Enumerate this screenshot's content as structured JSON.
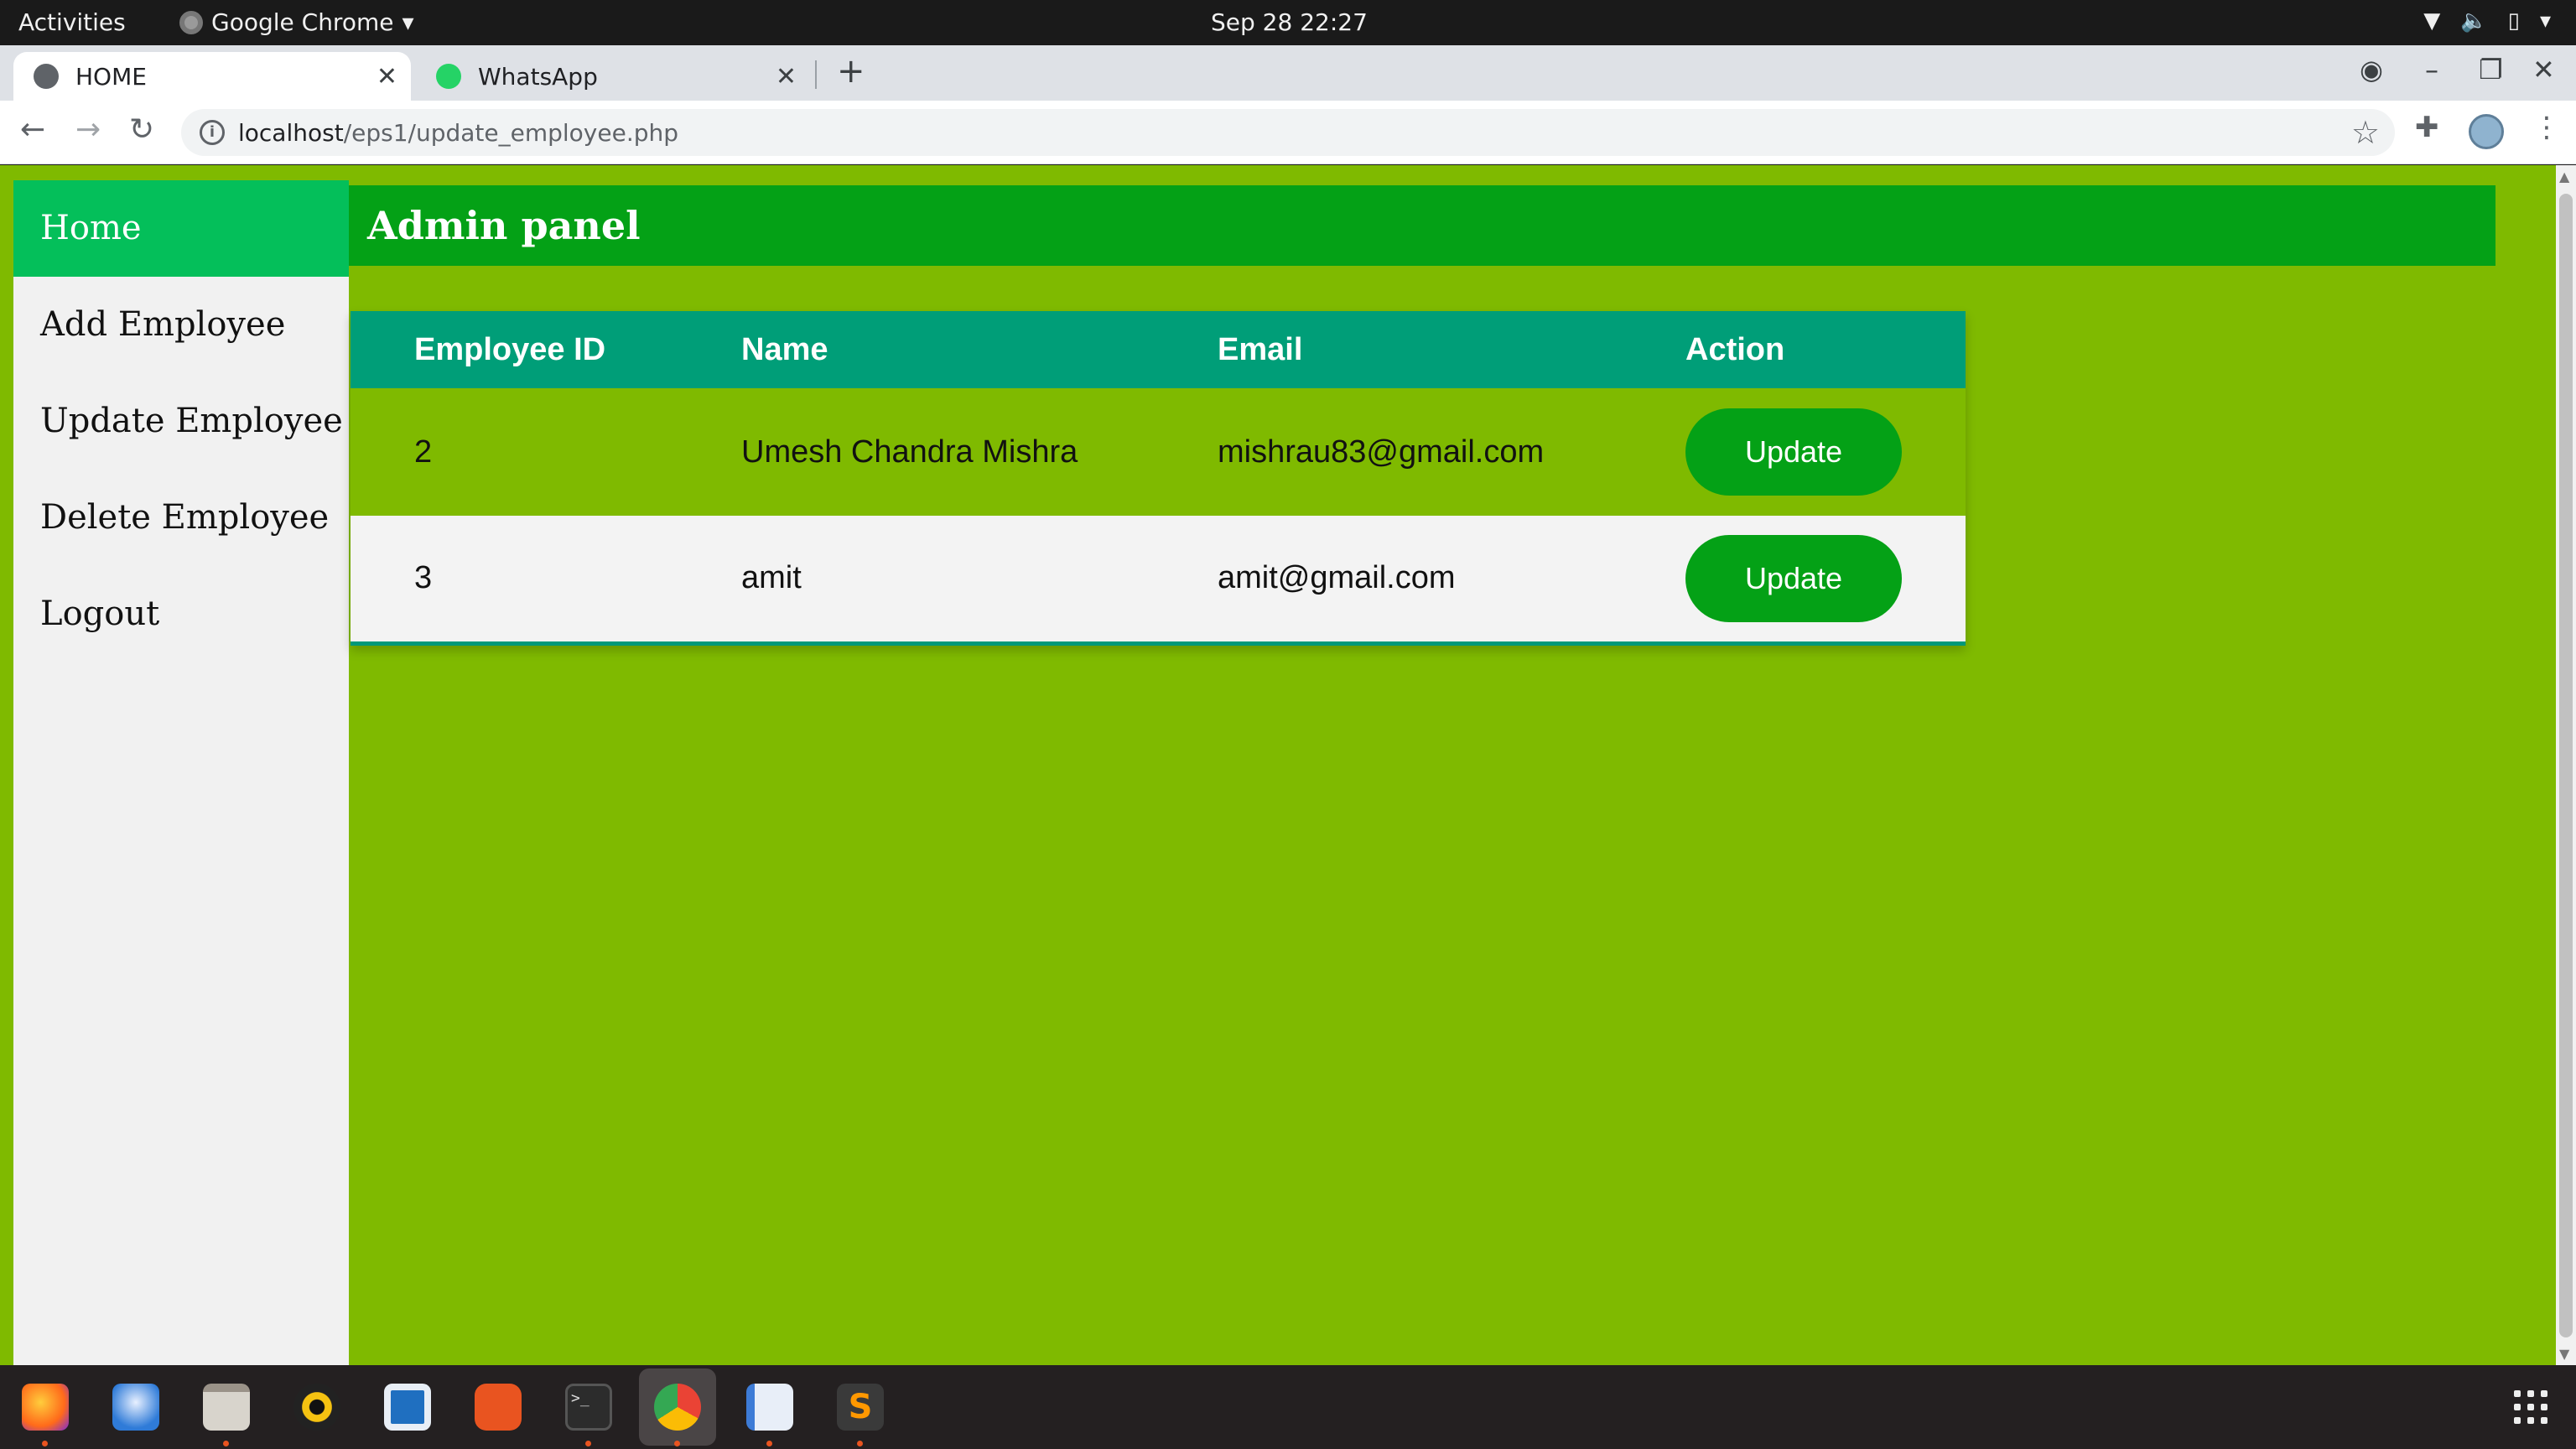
{
  "system_bar": {
    "activities": "Activities",
    "app_name": "Google Chrome",
    "clock": "Sep 28  22:27"
  },
  "browser": {
    "tabs": [
      {
        "label": "HOME",
        "favicon": "globe-icon"
      },
      {
        "label": "WhatsApp",
        "favicon": "whatsapp-icon"
      }
    ],
    "url_host": "localhost",
    "url_path": "/eps1/update_employee.php"
  },
  "page": {
    "sidebar": {
      "items": [
        {
          "label": "Home"
        },
        {
          "label": "Add Employee"
        },
        {
          "label": "Update Employee"
        },
        {
          "label": "Delete Employee"
        },
        {
          "label": "Logout"
        }
      ]
    },
    "header_title": "Admin panel",
    "table": {
      "headers": [
        "Employee ID",
        "Name",
        "Email",
        "Action"
      ],
      "rows": [
        {
          "id": "2",
          "name": "Umesh Chandra Mishra",
          "email": "mishrau83@gmail.com",
          "action": "Update"
        },
        {
          "id": "3",
          "name": "amit",
          "email": "amit@gmail.com",
          "action": "Update"
        }
      ]
    }
  },
  "colors": {
    "page_bg": "#7fba00",
    "header_bg": "#04a116",
    "sidebar_active": "#04bf5a",
    "table_header": "#009e78",
    "button": "#04a116"
  },
  "dock": {
    "apps": [
      "firefox-icon",
      "thunderbird-icon",
      "files-icon",
      "rhythmbox-icon",
      "writer-icon",
      "software-icon",
      "terminal-icon",
      "chrome-icon",
      "text-editor-icon",
      "sublime-icon"
    ]
  }
}
